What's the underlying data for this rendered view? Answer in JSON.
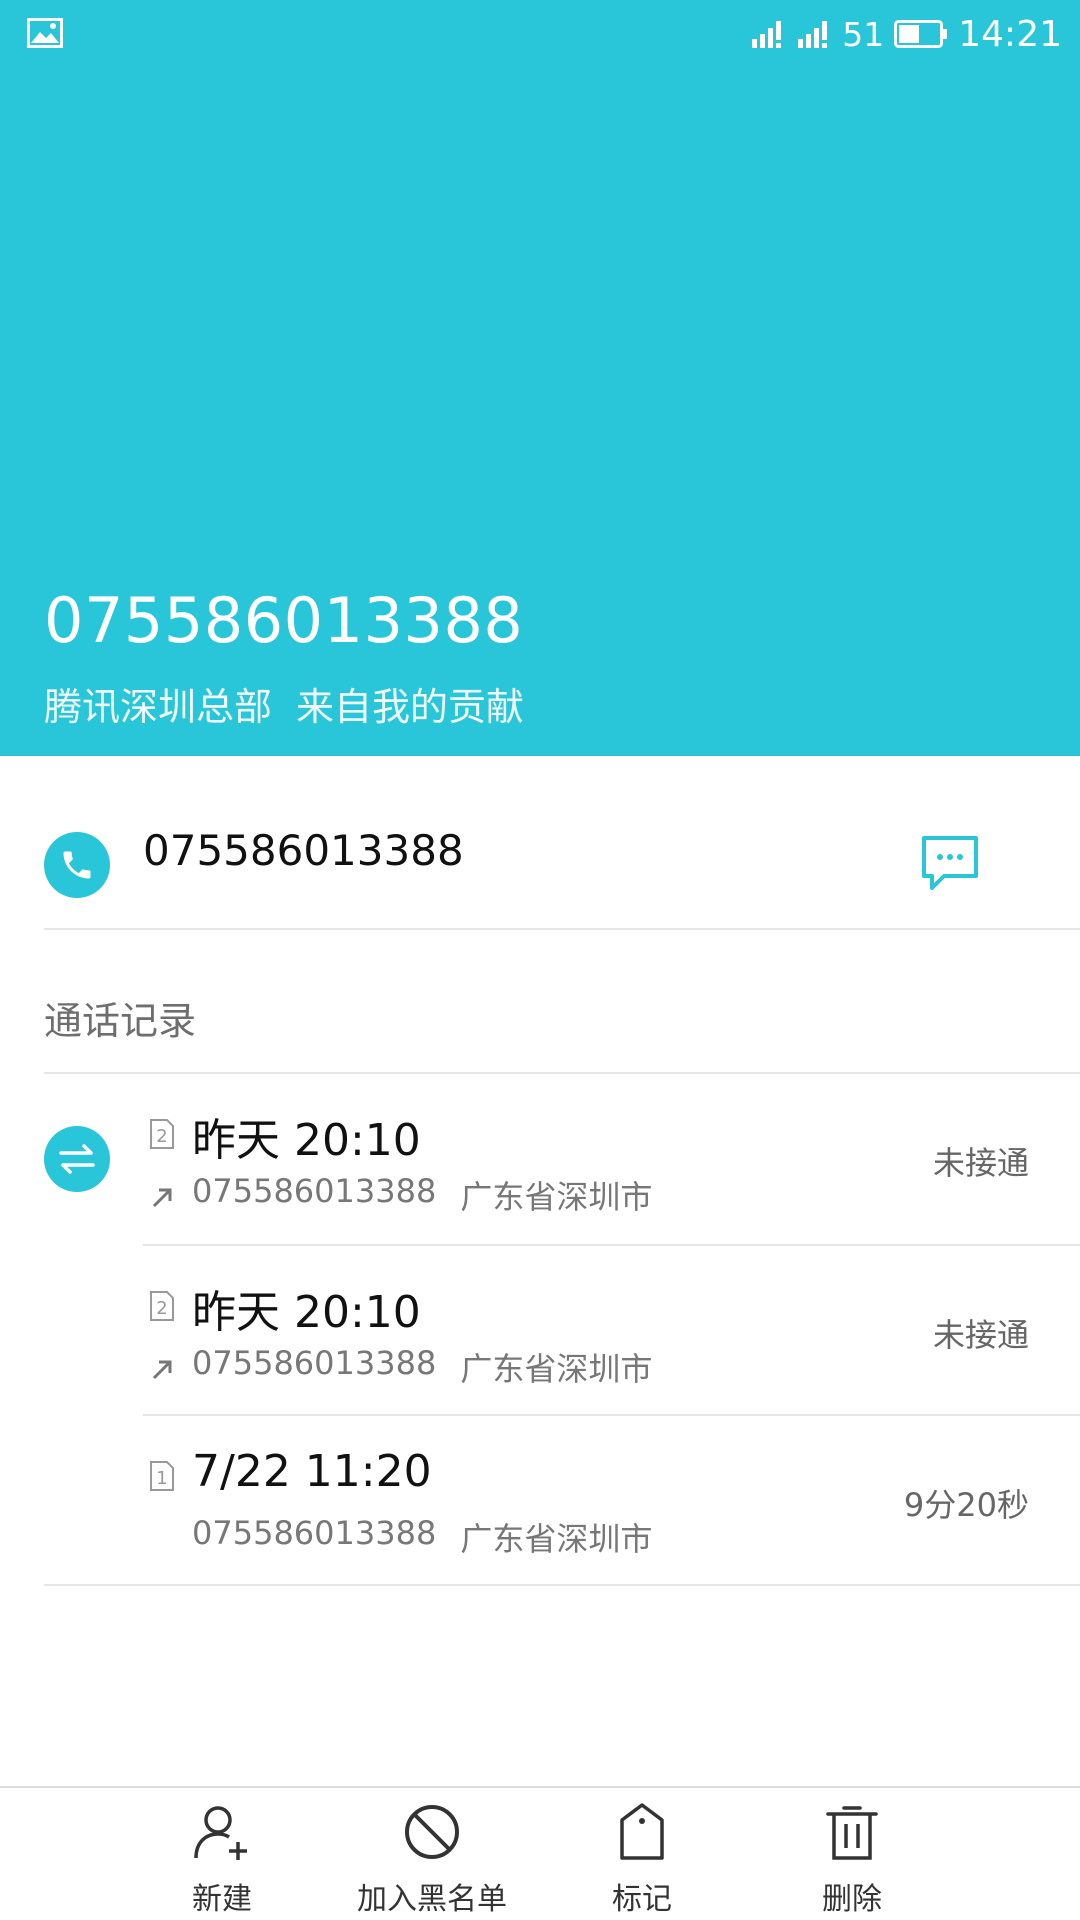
{
  "status_bar": {
    "network": "51",
    "time": "14:21",
    "icons": [
      "image-icon",
      "signal-icon",
      "signal-icon",
      "battery-icon"
    ]
  },
  "header": {
    "number": "075586013388",
    "company": "腾讯深圳总部",
    "source": "来自我的贡献",
    "background_color": "#29C5D8"
  },
  "contact": {
    "phone_number": "075586013388",
    "call_icon": "phone-icon",
    "message_icon": "message-icon"
  },
  "call_log": {
    "title": "通话记录",
    "items": [
      {
        "sim": "2",
        "time": "昨天 20:10",
        "direction": "outgoing",
        "number": "075586013388",
        "location": "广东省深圳市",
        "status": "未接通"
      },
      {
        "sim": "2",
        "time": "昨天 20:10",
        "direction": "outgoing",
        "number": "075586013388",
        "location": "广东省深圳市",
        "status": "未接通"
      },
      {
        "sim": "1",
        "time": "7/22 11:20",
        "direction": "",
        "number": "075586013388",
        "location": "广东省深圳市",
        "status": "9分20秒"
      }
    ]
  },
  "bottom_bar": {
    "items": [
      {
        "label": "新建",
        "icon": "add-contact-icon"
      },
      {
        "label": "加入黑名单",
        "icon": "block-icon"
      },
      {
        "label": "标记",
        "icon": "tag-icon"
      },
      {
        "label": "删除",
        "icon": "trash-icon"
      }
    ]
  }
}
